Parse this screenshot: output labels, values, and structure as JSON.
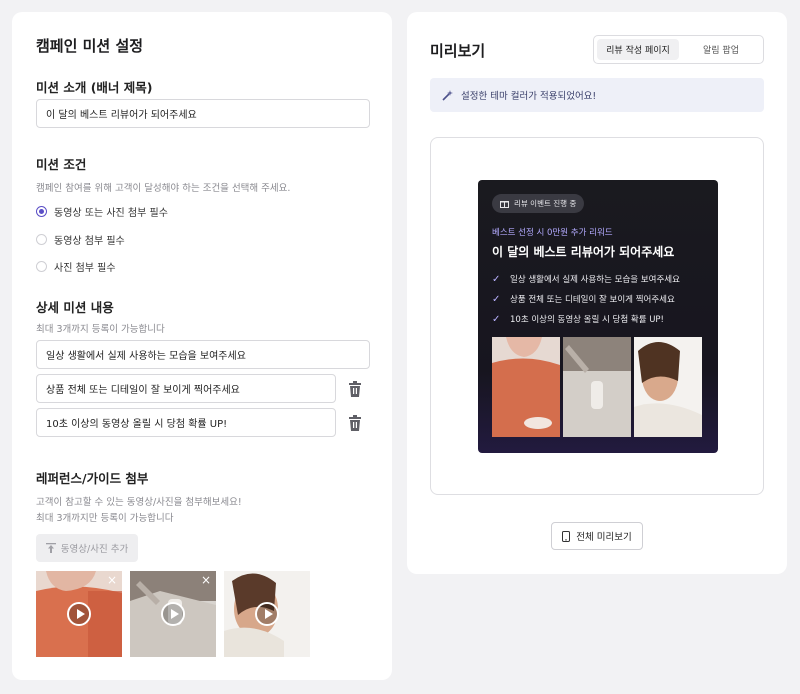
{
  "left": {
    "title": "캠페인 미션 설정",
    "intro": {
      "label": "미션 소개 (배너 제목)",
      "value": "이 달의 베스트 리뷰어가 되어주세요"
    },
    "conditions": {
      "label": "미션 조건",
      "hint": "캠페인 참여를 위해 고객이 달성해야 하는 조건을 선택해 주세요.",
      "options": [
        "동영상 또는 사진 첨부 필수",
        "동영상 첨부 필수",
        "사진 첨부 필수"
      ],
      "selected_index": 0
    },
    "details": {
      "label": "상세 미션 내용",
      "hint": "최대 3개까지 등록이 가능합니다",
      "items": [
        "일상 생활에서 실제 사용하는 모습을 보여주세요",
        "상품 전체 또는 디테일이 잘 보이게 찍어주세요",
        "10초 이상의 동영상 올릴 시 당첨 확률 UP!"
      ]
    },
    "reference": {
      "label": "레퍼런스/가이드 첨부",
      "hint1": "고객이 참고할 수 있는 동영상/사진을 첨부해보세요!",
      "hint2": "최대 3개까지만 등록이 가능합니다",
      "add_button": "동영상/사진 추가",
      "close_glyph": "×"
    }
  },
  "right": {
    "title": "미리보기",
    "tabs": [
      "리뷰 작성 페이지",
      "알림 팝업"
    ],
    "active_tab": 0,
    "notice": "설정한 테마 컬러가 적용되었어요!",
    "preview": {
      "badge": "리뷰 이벤트 진행 중",
      "subtitle": "베스트 선정 시 0만원 추가 리워드",
      "title": "이 달의 베스트 리뷰어가 되어주세요",
      "checks": [
        "일상 생활에서 실제 사용하는 모습을 보여주세요",
        "상품 전체 또는 디테일이 잘 보이게 찍어주세요",
        "10초 이상의 동영상 올릴 시 당첨 확률 UP!"
      ],
      "check_glyph": "✓"
    },
    "full_preview_button": "전체 미리보기"
  },
  "colors": {
    "accent": "#5b4fc6",
    "preview_subtitle": "#b3aaff",
    "notice_bg": "#eef0f8"
  },
  "icons": [
    "trash-icon",
    "play-icon",
    "close-icon",
    "magic-wand-icon",
    "gift-icon",
    "check-icon",
    "phone-icon",
    "upload-icon"
  ]
}
